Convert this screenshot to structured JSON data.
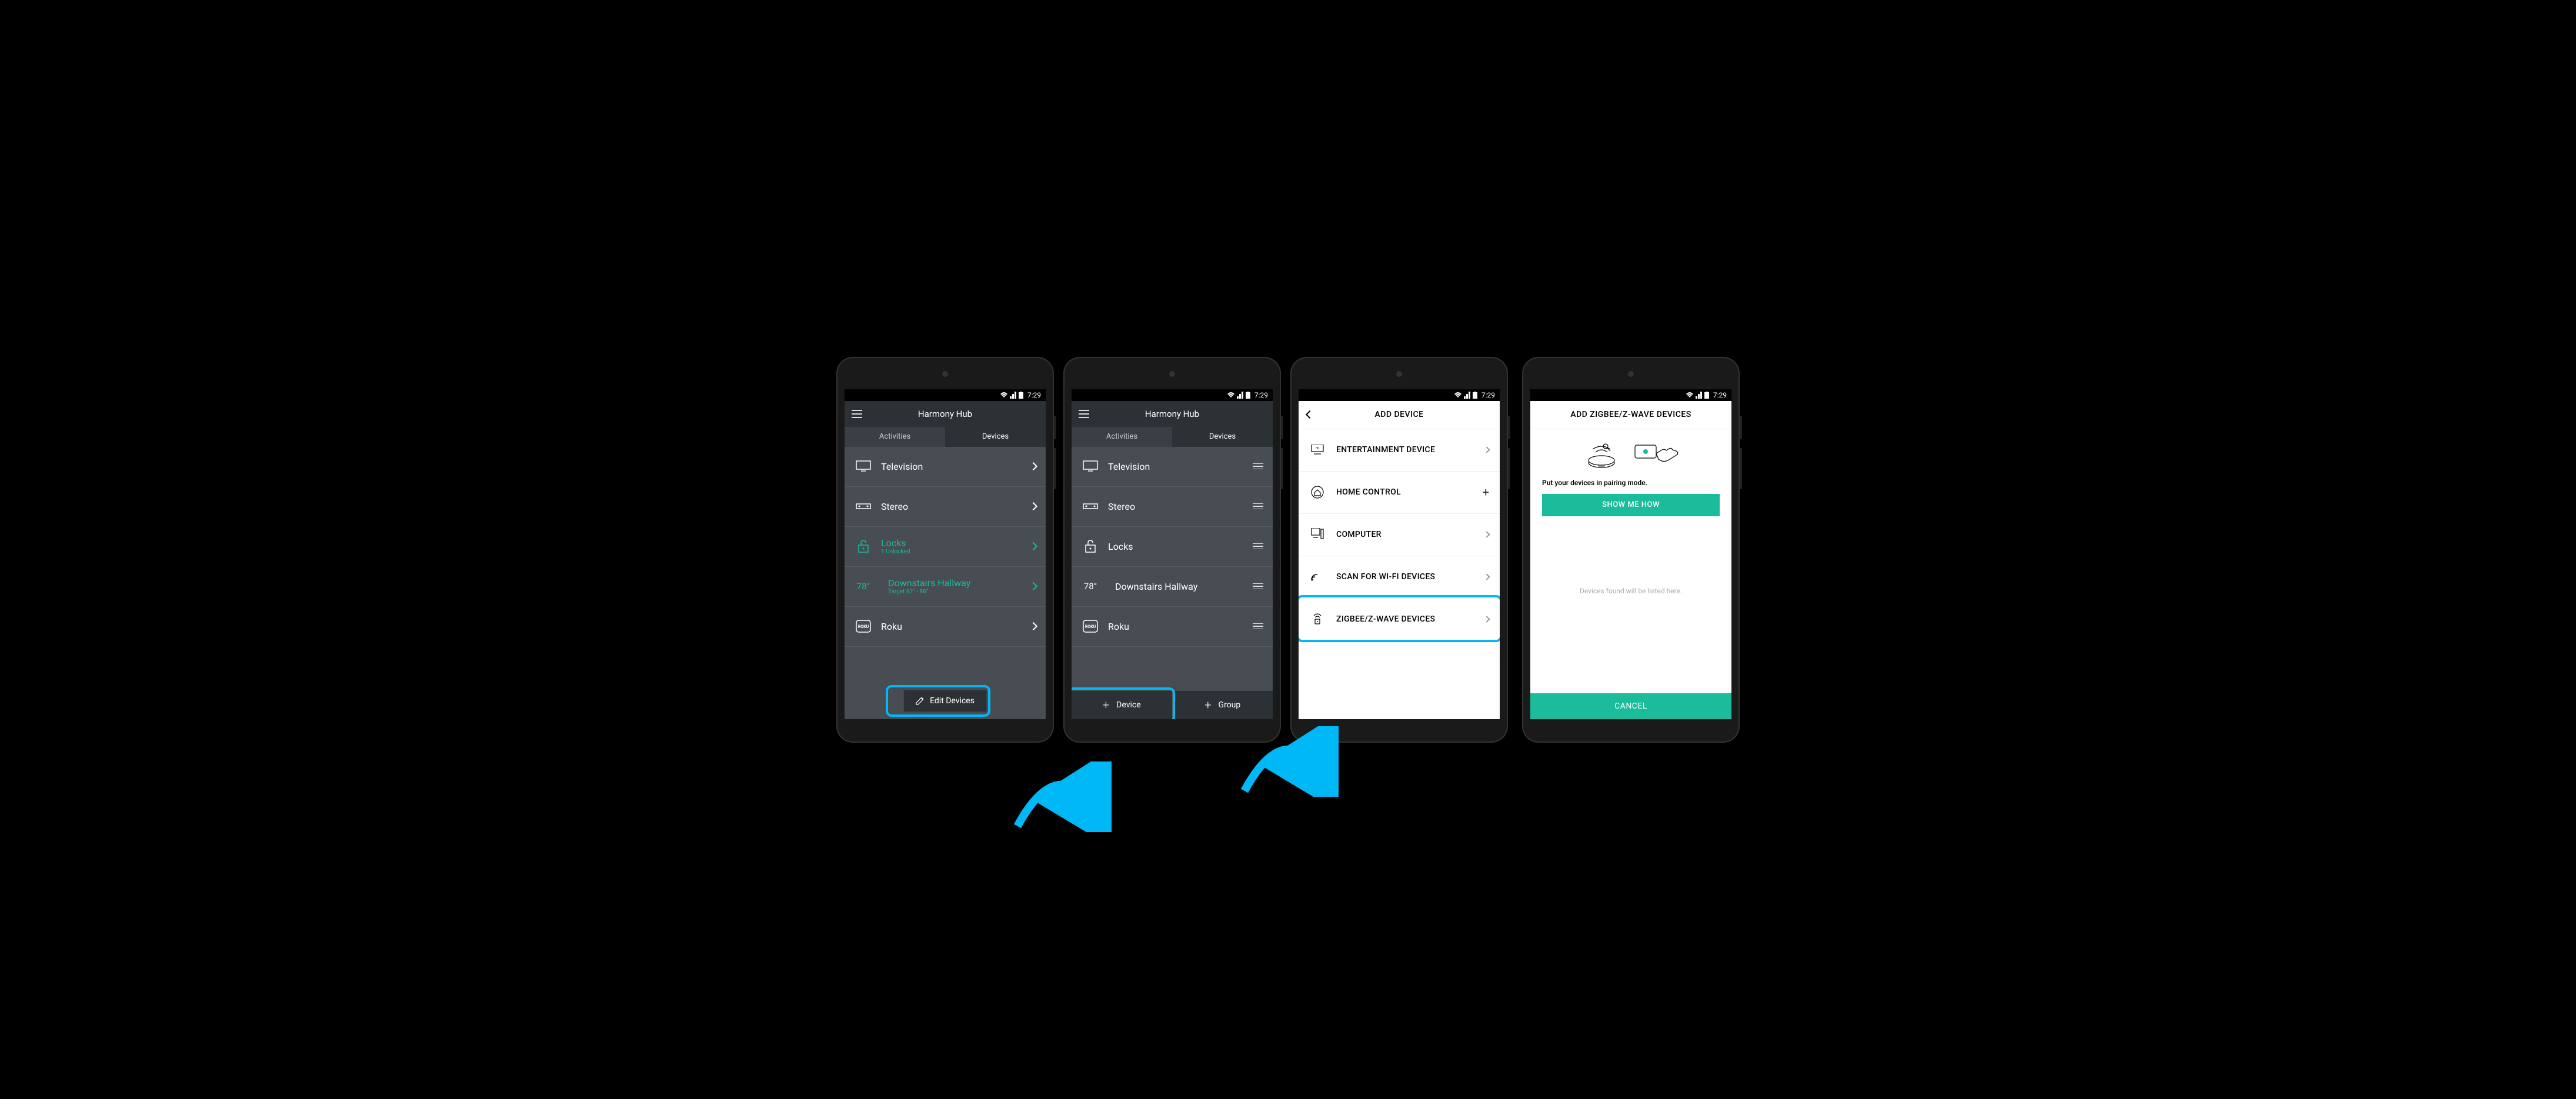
{
  "statusbar": {
    "time": "7:29"
  },
  "screen1": {
    "title": "Harmony Hub",
    "tabs": {
      "activities": "Activities",
      "devices": "Devices"
    },
    "items": [
      {
        "label": "Television"
      },
      {
        "label": "Stereo"
      },
      {
        "label": "Locks",
        "sub": "1 Unlocked"
      },
      {
        "temp": "78°",
        "label": "Downstairs Hallway",
        "sub": "Target  62° - 86°"
      },
      {
        "label": "Roku"
      }
    ],
    "edit": "Edit Devices"
  },
  "screen2": {
    "title": "Harmony Hub",
    "tabs": {
      "activities": "Activities",
      "devices": "Devices"
    },
    "items": [
      {
        "label": "Television"
      },
      {
        "label": "Stereo"
      },
      {
        "label": "Locks"
      },
      {
        "temp": "78°",
        "label": "Downstairs Hallway"
      },
      {
        "label": "Roku"
      }
    ],
    "add_device": "Device",
    "add_group": "Group"
  },
  "screen3": {
    "title": "ADD DEVICE",
    "cats": [
      {
        "label": "ENTERTAINMENT DEVICE"
      },
      {
        "label": "HOME CONTROL"
      },
      {
        "label": "COMPUTER"
      },
      {
        "label": "SCAN FOR WI-FI DEVICES"
      },
      {
        "label": "ZIGBEE/Z-WAVE DEVICES"
      }
    ]
  },
  "screen4": {
    "title": "ADD ZIGBEE/Z-WAVE DEVICES",
    "pairing": "Put your devices in pairing mode.",
    "show": "SHOW ME HOW",
    "found": "Devices found will be listed here.",
    "cancel": "CANCEL"
  },
  "roku_label": "ROKU"
}
